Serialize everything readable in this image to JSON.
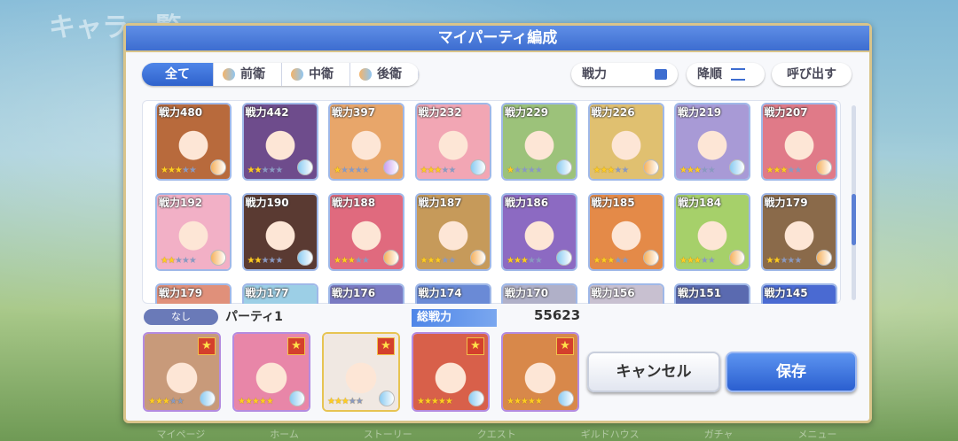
{
  "background": {
    "title": "キャラ一覧",
    "nav": [
      "マイページ",
      "ホーム",
      "ストーリー",
      "クエスト",
      "ギルドハウス",
      "ガチャ",
      "メニュー"
    ]
  },
  "dialog": {
    "title": "マイパーティ編成"
  },
  "filters": [
    {
      "label": "全て",
      "active": true
    },
    {
      "label": "前衛"
    },
    {
      "label": "中衛"
    },
    {
      "label": "後衛"
    }
  ],
  "sort": {
    "key": "戦力",
    "order": "降順",
    "recall": "呼び出す"
  },
  "roster": [
    {
      "power": "戦力480",
      "stars": 3,
      "pos": "f",
      "color": "#b86a3c"
    },
    {
      "power": "戦力442",
      "stars": 2,
      "pos": "m",
      "color": "#6e4c8c"
    },
    {
      "power": "戦力397",
      "stars": 1,
      "pos": "b",
      "color": "#e8a66a"
    },
    {
      "power": "戦力232",
      "stars": 3,
      "pos": "m",
      "color": "#f2a6b4"
    },
    {
      "power": "戦力229",
      "stars": 1,
      "pos": "m",
      "color": "#9cc27a"
    },
    {
      "power": "戦力226",
      "stars": 3,
      "pos": "f",
      "color": "#e0c070"
    },
    {
      "power": "戦力219",
      "stars": 3,
      "pos": "m",
      "color": "#a89ad6"
    },
    {
      "power": "戦力207",
      "stars": 3,
      "pos": "f",
      "color": "#e07a88"
    },
    {
      "power": "戦力192",
      "stars": 2,
      "pos": "f",
      "color": "#f2b0c6"
    },
    {
      "power": "戦力190",
      "stars": 2,
      "pos": "m",
      "color": "#5a3a32"
    },
    {
      "power": "戦力188",
      "stars": 3,
      "pos": "f",
      "color": "#e06a7e"
    },
    {
      "power": "戦力187",
      "stars": 3,
      "pos": "f",
      "color": "#c69a5a"
    },
    {
      "power": "戦力186",
      "stars": 3,
      "pos": "m",
      "color": "#8c6ac2"
    },
    {
      "power": "戦力185",
      "stars": 3,
      "pos": "f",
      "color": "#e48a48"
    },
    {
      "power": "戦力184",
      "stars": 3,
      "pos": "f",
      "color": "#a6d06a"
    },
    {
      "power": "戦力179",
      "stars": 2,
      "pos": "f",
      "color": "#8a6a4a"
    },
    {
      "power": "戦力179",
      "stars": 2,
      "pos": "f",
      "color": "#e0907a"
    },
    {
      "power": "戦力177",
      "stars": 2,
      "pos": "m",
      "color": "#9ccfe6"
    },
    {
      "power": "戦力176",
      "stars": 2,
      "pos": "m",
      "color": "#7a7ac2"
    },
    {
      "power": "戦力174",
      "stars": 2,
      "pos": "m",
      "color": "#6a8ad6"
    },
    {
      "power": "戦力170",
      "stars": 2,
      "pos": "b",
      "color": "#b0b0c8"
    },
    {
      "power": "戦力156",
      "stars": 2,
      "pos": "m",
      "color": "#c8c0d0"
    },
    {
      "power": "戦力151",
      "stars": 2,
      "pos": "m",
      "color": "#5a6ab0"
    },
    {
      "power": "戦力145",
      "stars": 2,
      "pos": "m",
      "color": "#4a6ad2"
    }
  ],
  "party": {
    "tag": "なし",
    "name": "パーティ1",
    "total_label": "総戦力",
    "total_value": "55623",
    "members": [
      {
        "stars": 3,
        "color": "#c89a7a",
        "frame": "r2"
      },
      {
        "stars": 5,
        "color": "#e886a8",
        "frame": "r2"
      },
      {
        "stars": 3,
        "color": "#f0e8e2",
        "frame": "r3"
      },
      {
        "stars": 5,
        "color": "#d8604a",
        "frame": "r2"
      },
      {
        "stars": 5,
        "color": "#d8884a",
        "frame": "r2"
      }
    ]
  },
  "buttons": {
    "cancel": "キャンセル",
    "save": "保存"
  }
}
